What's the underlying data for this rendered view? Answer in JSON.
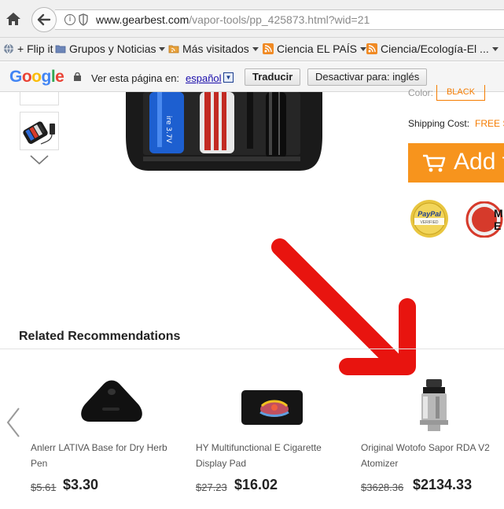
{
  "browser": {
    "url_host": "www.gearbest.com",
    "url_path": "/vapor-tools/pp_425873.html?wid=21"
  },
  "bookmarks": [
    {
      "label": "+ Flip it",
      "icon": "globe-icon",
      "has_menu": false
    },
    {
      "label": "Grupos y Noticias",
      "icon": "folder-icon",
      "has_menu": true
    },
    {
      "label": "Más visitados",
      "icon": "rss-folder-icon",
      "has_menu": true
    },
    {
      "label": "Ciencia EL PAÍS",
      "icon": "rss-icon",
      "has_menu": true
    },
    {
      "label": "Ciencia/Ecología-El ...",
      "icon": "rss-icon",
      "has_menu": true
    }
  ],
  "translate_bar": {
    "logo": "Google",
    "prompt": "Ver esta página en:",
    "language": "español",
    "translate_button": "Traducir",
    "disable_button": "Desactivar para: inglés"
  },
  "product": {
    "color_label": "Color:",
    "color_value": "BLACK",
    "shipping_label": "Shipping Cost:",
    "shipping_value": "FREE S",
    "add_button": "Add t",
    "paypal_badge": "PayPal VERIFIED",
    "badge2_text": "M\nE"
  },
  "related": {
    "title": "Related Recommendations",
    "items": [
      {
        "name": "Anlerr LATIVA Base for Dry Herb Pen",
        "old_price": "$5.61",
        "price": "$3.30"
      },
      {
        "name": "HY Multifunctional E Cigarette Display Pad",
        "old_price": "$27.23",
        "price": "$16.02"
      },
      {
        "name": "Original Wotofo Sapor RDA V2 Atomizer",
        "old_price": "$3628.36",
        "price": "$2134.33"
      }
    ]
  },
  "colors": {
    "accent": "#f7941d",
    "arrow": "#e8140f",
    "link": "#1a0dab"
  }
}
